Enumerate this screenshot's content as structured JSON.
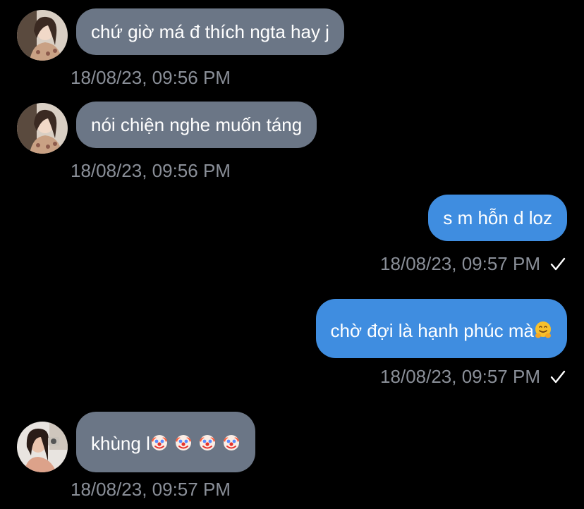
{
  "messages": [
    {
      "direction": "incoming",
      "text": "chứ giờ má đ thích ngta hay j",
      "time": "18/08/23, 09:56 PM"
    },
    {
      "direction": "incoming",
      "text": "nói chiện nghe muốn táng",
      "time": "18/08/23, 09:56 PM"
    },
    {
      "direction": "outgoing",
      "text": "s m hỗn d loz",
      "time": "18/08/23, 09:57 PM",
      "status": "sent-check-icon"
    },
    {
      "direction": "outgoing",
      "text": "chờ đợi là hạnh phúc mà",
      "emoji": "hugging-face-emoji",
      "time": "18/08/23, 09:57 PM",
      "status": "sent-check-icon"
    },
    {
      "direction": "incoming",
      "text": "khùng l",
      "emoji": "clown-face-emoji",
      "time": "18/08/23, 09:57 PM"
    }
  ],
  "colors": {
    "background": "#000000",
    "incoming_bubble": "#6b7686",
    "outgoing_bubble": "#3f8de0",
    "timestamp": "#8a8f98"
  }
}
